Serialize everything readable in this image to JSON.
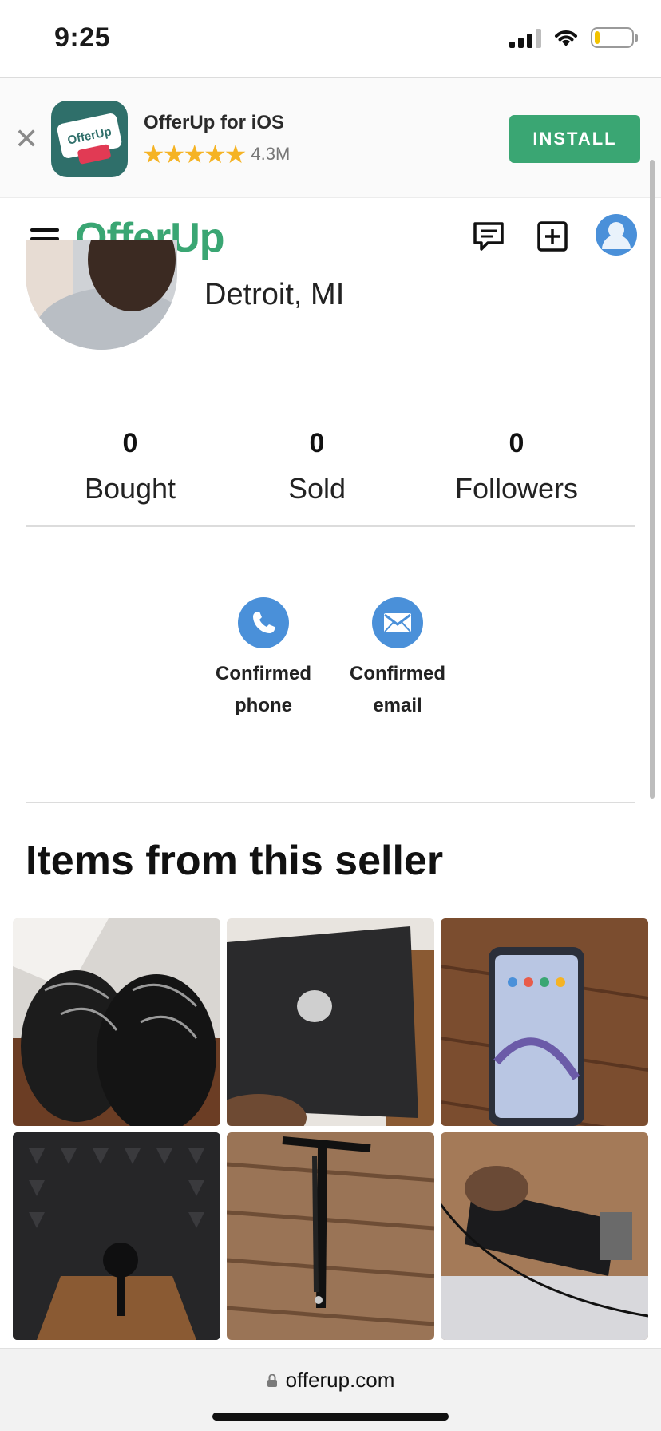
{
  "status_bar": {
    "time": "9:25"
  },
  "app_banner": {
    "app_name": "OfferUp for iOS",
    "rating_stars": "★★★★★",
    "review_count": "4.3M",
    "install_label": "INSTALL",
    "close_glyph": "✕",
    "icon_text": "OfferUp"
  },
  "header": {
    "logo": "OfferUp"
  },
  "profile": {
    "location": "Detroit, MI"
  },
  "stats": [
    {
      "value": "0",
      "label": "Bought"
    },
    {
      "value": "0",
      "label": "Sold"
    },
    {
      "value": "0",
      "label": "Followers"
    }
  ],
  "verifications": [
    {
      "icon": "phone-icon",
      "line1": "Confirmed",
      "line2": "phone"
    },
    {
      "icon": "email-icon",
      "line1": "Confirmed",
      "line2": "email"
    }
  ],
  "items_section": {
    "title": "Items from this seller",
    "items": [
      {
        "name": "black-sneakers"
      },
      {
        "name": "black-console"
      },
      {
        "name": "smartphone"
      },
      {
        "name": "mic-isolation-shield"
      },
      {
        "name": "mic-boom-arm"
      },
      {
        "name": "microphone"
      }
    ]
  },
  "browser": {
    "url": "offerup.com"
  },
  "colors": {
    "brand_green": "#3aa673",
    "verify_blue": "#4a90d9",
    "star_gold": "#f5b324"
  }
}
